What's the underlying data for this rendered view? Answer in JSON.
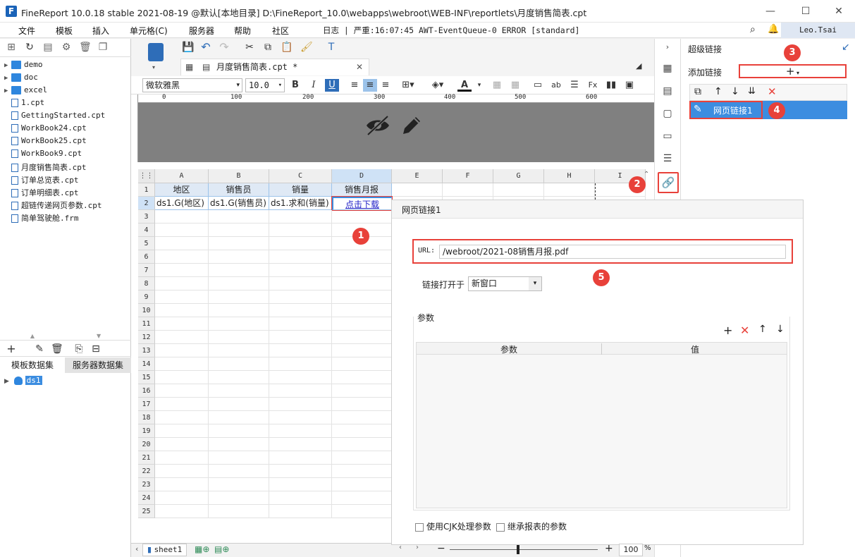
{
  "window": {
    "title": "FineReport 10.0.18 stable 2021-08-19 @默认[本地目录]   D:\\FineReport_10.0\\webapps\\webroot\\WEB-INF\\reportlets\\月度销售简表.cpt",
    "logo": "F"
  },
  "menu": {
    "items": [
      "文件",
      "模板",
      "插入",
      "单元格(C)",
      "服务器",
      "帮助",
      "社区"
    ],
    "log": "日志 | 严重:16:07:45 AWT-EventQueue-0 ERROR [standard]",
    "user": "Leo.Tsai"
  },
  "tree": {
    "items": [
      {
        "label": "demo",
        "type": "folder"
      },
      {
        "label": "doc",
        "type": "folder"
      },
      {
        "label": "excel",
        "type": "folder"
      },
      {
        "label": "1.cpt",
        "type": "file"
      },
      {
        "label": "GettingStarted.cpt",
        "type": "file"
      },
      {
        "label": "WorkBook24.cpt",
        "type": "file"
      },
      {
        "label": "WorkBook25.cpt",
        "type": "file"
      },
      {
        "label": "WorkBook9.cpt",
        "type": "file"
      },
      {
        "label": "月度销售简表.cpt",
        "type": "file"
      },
      {
        "label": "订单总览表.cpt",
        "type": "file"
      },
      {
        "label": "订单明细表.cpt",
        "type": "file"
      },
      {
        "label": "超链传递网页参数.cpt",
        "type": "file"
      },
      {
        "label": "简单驾驶舱.frm",
        "type": "file"
      }
    ]
  },
  "datasets": {
    "tab1": "模板数据集",
    "tab2": "服务器数据集",
    "item": "ds1"
  },
  "doc_tab": {
    "label": "月度销售简表.cpt *"
  },
  "format": {
    "font": "微软雅黑",
    "size": "10.0"
  },
  "ruler": [
    "0",
    "100",
    "200",
    "300",
    "400",
    "500",
    "600"
  ],
  "columns": [
    "A",
    "B",
    "C",
    "D",
    "E",
    "F",
    "G",
    "H",
    "I"
  ],
  "rows": [
    "1",
    "2",
    "3",
    "4",
    "5",
    "6",
    "7",
    "8",
    "9",
    "10",
    "11",
    "12",
    "13",
    "14",
    "15",
    "16",
    "17",
    "18",
    "19",
    "20",
    "21",
    "22",
    "23",
    "24",
    "25"
  ],
  "cells": {
    "r1": [
      "地区",
      "销售员",
      "销量",
      "销售月报"
    ],
    "r2": [
      "ds1.G(地区)",
      "ds1.G(销售员)",
      "ds1.求和(销量)",
      "点击下载"
    ]
  },
  "sheet": {
    "name": "sheet1",
    "zoom": "100",
    "zoom_unit": "%"
  },
  "hyperlink_panel": {
    "title": "超级链接",
    "add_label": "添加链接",
    "add_btn": "+",
    "item": "网页链接1"
  },
  "dialog": {
    "title": "网页链接1",
    "url_label": "URL:",
    "url_value": "/webroot/2021-08销售月报.pdf",
    "open_label": "链接打开于",
    "open_value": "新窗口",
    "params_label": "参数",
    "col_param": "参数",
    "col_value": "值",
    "cjk": "使用CJK处理参数",
    "inherit": "继承报表的参数"
  },
  "badges": [
    "1",
    "2",
    "3",
    "4",
    "5"
  ],
  "colors": {
    "accent": "#e8413a",
    "select": "#3c8de0",
    "link": "#2323c8"
  }
}
